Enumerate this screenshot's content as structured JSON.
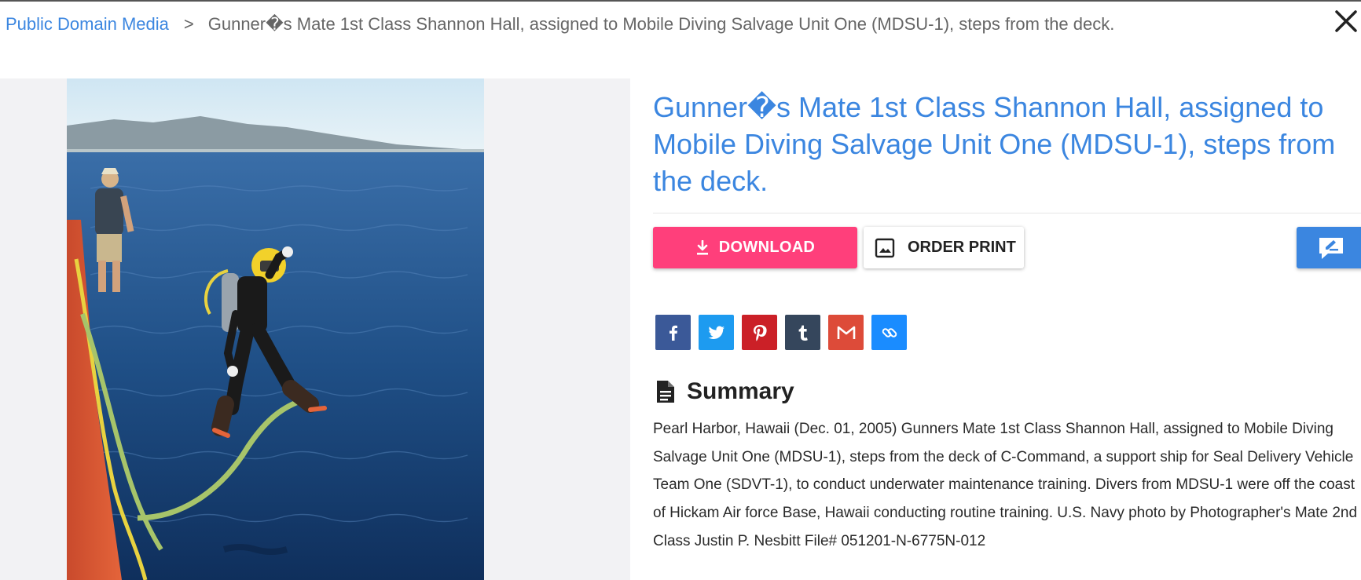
{
  "breadcrumb": {
    "root": "Public Domain Media",
    "separator": ">",
    "current": "Gunner�s Mate 1st Class Shannon Hall, assigned to Mobile Diving Salvage Unit One (MDSU-1), steps from the deck."
  },
  "title": "Gunner�s Mate 1st Class Shannon Hall, assigned to Mobile Diving Salvage Unit One (MDSU-1), steps from the deck.",
  "actions": {
    "download_label": "DOWNLOAD",
    "order_print_label": "ORDER PRINT"
  },
  "share": [
    {
      "icon": "facebook-icon",
      "glyph": "f",
      "color": "#3b5998"
    },
    {
      "icon": "twitter-icon",
      "glyph": "",
      "color": "#1d9bf0"
    },
    {
      "icon": "pinterest-icon",
      "glyph": "P",
      "color": "#cb2027"
    },
    {
      "icon": "tumblr-icon",
      "glyph": "t",
      "color": "#35465c"
    },
    {
      "icon": "gmail-icon",
      "glyph": "M",
      "color": "#dd4b39"
    },
    {
      "icon": "link-icon",
      "glyph": "",
      "color": "#1a8cff"
    }
  ],
  "summary": {
    "heading": "Summary",
    "text": "Pearl Harbor, Hawaii (Dec. 01, 2005) Gunners Mate 1st Class Shannon Hall, assigned to Mobile Diving Salvage Unit One (MDSU-1), steps from the deck of C-Command, a support ship for Seal Delivery Vehicle Team One (SDVT-1), to conduct underwater maintenance training. Divers from MDSU-1 were off the coast of Hickam Air force Base, Hawaii conducting routine training. U.S. Navy photo by Photographer's Mate 2nd Class Justin P. Nesbitt File# 051201-N-6775N-012"
  },
  "colors": {
    "accent": "#3b86e0",
    "download": "#ff3f7b"
  }
}
